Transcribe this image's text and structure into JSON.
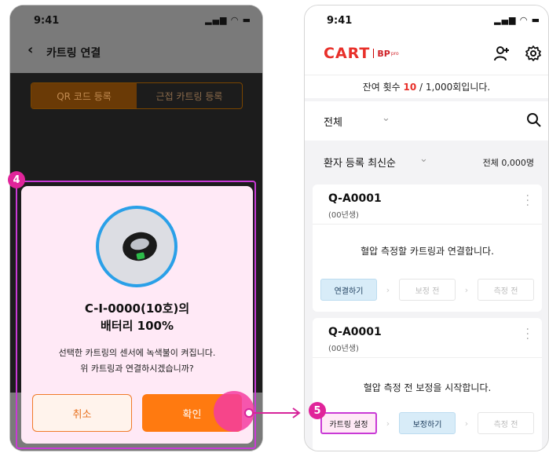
{
  "left_phone": {
    "status_time": "9:41",
    "status_icons": "▂▄▆ ◠ ▬",
    "back_icon": "‹",
    "title": "카트링 연결",
    "tabs": [
      {
        "label": "QR 코드 등록",
        "active": true
      },
      {
        "label": "근접 카트링 등록",
        "active": false
      }
    ],
    "dialog": {
      "title_line1": "C-I-0000(10호)의",
      "title_line2": "배터리 100%",
      "desc_line1": "선택한 카트링의 센서에 녹색불이 켜집니다.",
      "desc_line2": "위 카트링과 연결하시겠습니까?",
      "cancel_label": "취소",
      "confirm_label": "확인"
    }
  },
  "annotations": {
    "step4": "4",
    "step5": "5"
  },
  "right_phone": {
    "status_time": "9:41",
    "status_icons": "▂▄▆ ◠ ▬",
    "logo_cart": "CART",
    "logo_bp": "BP",
    "logo_pro": "pro",
    "remain_prefix": "잔여 횟수 ",
    "remain_value": "10",
    "remain_suffix": " / 1,000회입니다.",
    "filter_label": "전체",
    "sort_label": "환자 등록 최신순",
    "total_count": "전체 0,000명",
    "cards": [
      {
        "id": "Q-A0001",
        "birth": "(00년생)",
        "message": "혈압 측정할 카트링과 연결합니다.",
        "steps": [
          "연결하기",
          "보정 전",
          "측정 전"
        ]
      },
      {
        "id": "Q-A0001",
        "birth": "(00년생)",
        "message": "혈압 측정 전 보정을 시작합니다.",
        "steps": [
          "카트링 설정",
          "보정하기",
          "측정 전"
        ]
      }
    ]
  },
  "colors": {
    "accent_orange": "#ff7a10",
    "annotation_magenta": "#e0249a",
    "brand_red": "#e8302a",
    "step_active_blue": "#d8ecf8"
  }
}
